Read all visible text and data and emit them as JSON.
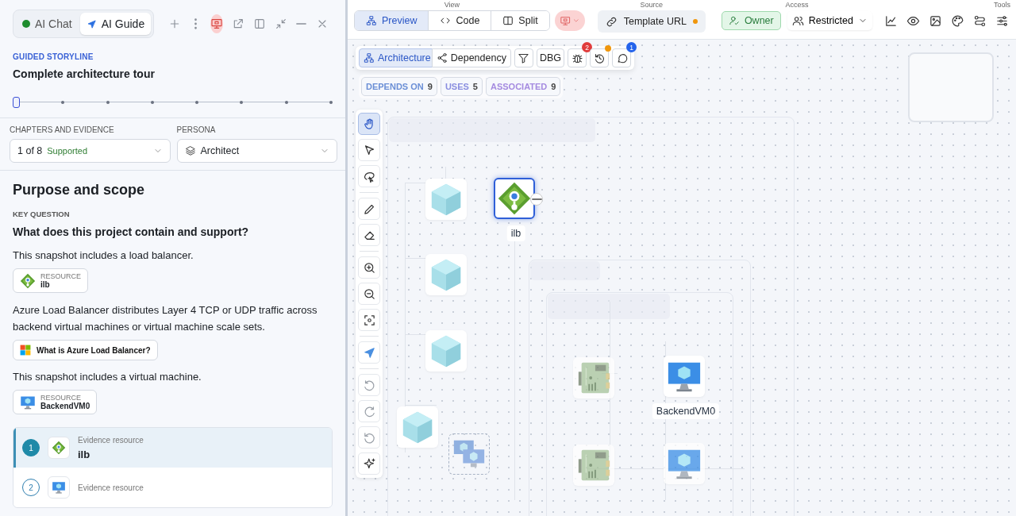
{
  "panel_tabs": [
    {
      "label": "AI Chat",
      "kind": "chat",
      "selected": false
    },
    {
      "label": "AI Guide",
      "kind": "guide",
      "selected": true
    }
  ],
  "panel_actions": [
    {
      "kind": "plus",
      "active": false
    },
    {
      "kind": "more",
      "active": false
    },
    {
      "kind": "present",
      "active": true
    },
    {
      "kind": "popout",
      "active": false
    },
    {
      "kind": "sidebar",
      "active": false
    },
    {
      "kind": "collapse",
      "active": false
    },
    {
      "kind": "minimize",
      "active": false
    },
    {
      "kind": "close",
      "active": false
    }
  ],
  "guide": {
    "eyebrow": "GUIDED STORYLINE",
    "title": "Complete architecture tour",
    "steps": [
      {
        "selected": true
      },
      {
        "selected": false
      },
      {
        "selected": false
      },
      {
        "selected": false
      },
      {
        "selected": false
      },
      {
        "selected": false
      },
      {
        "selected": false
      },
      {
        "selected": false
      }
    ]
  },
  "chapters": {
    "label": "CHAPTERS AND EVIDENCE",
    "value": "1 of 8",
    "status": "Supported"
  },
  "persona": {
    "label": "PERSONA",
    "value": "Architect"
  },
  "section": {
    "heading": "Purpose and scope",
    "key_label": "KEY QUESTION",
    "question": "What does this project contain and support?",
    "blocks": [
      {
        "kind": "text",
        "text": "This snapshot includes a load balancer."
      },
      {
        "kind": "lb_resource",
        "label": "RESOURCE",
        "name": "ilb"
      },
      {
        "kind": "text",
        "text": "Azure Load Balancer distributes Layer 4 TCP or UDP traffic across backend virtual machines or virtual machine scale sets."
      },
      {
        "kind": "link",
        "text": "What is Azure Load Balancer?"
      },
      {
        "kind": "text",
        "text": "This snapshot includes a virtual machine."
      },
      {
        "kind": "vm_resource",
        "label": "RESOURCE",
        "name": "BackendVM0"
      }
    ]
  },
  "evidence": [
    {
      "number": "1",
      "kind": "lb",
      "label": "Evidence resource",
      "name": "ilb",
      "selected": true
    },
    {
      "number": "2",
      "kind": "vm",
      "label": "Evidence resource",
      "selected": false
    }
  ],
  "topbar": {
    "view": {
      "label": "View",
      "tabs": [
        {
          "label": "Preview",
          "kind": "preview",
          "selected": true
        },
        {
          "label": "Code",
          "kind": "code",
          "selected": false
        },
        {
          "label": "Split",
          "kind": "split",
          "selected": false
        }
      ]
    },
    "source": {
      "label": "Source",
      "button": "Template URL",
      "modified": true
    },
    "access": {
      "label": "Access",
      "role": "Owner",
      "visibility": "Restricted"
    },
    "tools": {
      "label": "Tools",
      "items": [
        {
          "kind": "chart"
        },
        {
          "kind": "eye"
        },
        {
          "kind": "image"
        },
        {
          "kind": "palette"
        },
        {
          "kind": "flow"
        },
        {
          "kind": "sliders"
        }
      ]
    }
  },
  "canvas_toolbar": {
    "modes": [
      {
        "label": "Architecture",
        "kind": "arch",
        "selected": true
      },
      {
        "label": "Dependency",
        "kind": "dep",
        "selected": false
      }
    ],
    "debug": "DBG",
    "issues": "2",
    "history_dot": true,
    "comments": "1"
  },
  "filters": [
    {
      "label": "DEPENDS ON",
      "count": "9",
      "color": "#6b8fd6"
    },
    {
      "label": "USES",
      "count": "5",
      "color": "#8a8ee0"
    },
    {
      "label": "ASSOCIATED",
      "count": "9",
      "color": "#a58be0"
    }
  ],
  "tools": [
    {
      "kind": "hand",
      "selected": true
    },
    {
      "kind": "pointer",
      "selected": false
    },
    {
      "kind": "lasso",
      "selected": false
    },
    {
      "kind": "pencil",
      "selected": false
    },
    {
      "kind": "eraser",
      "selected": false
    },
    {
      "kind": "zoomin",
      "selected": false
    },
    {
      "kind": "zoomout",
      "selected": false
    },
    {
      "kind": "fit",
      "selected": false
    },
    {
      "kind": "send",
      "selected": false
    },
    {
      "kind": "undo",
      "selected": false
    },
    {
      "kind": "redo",
      "selected": false
    },
    {
      "kind": "reset",
      "selected": false
    },
    {
      "kind": "sparkle",
      "selected": false
    }
  ],
  "nodes": [
    {
      "kind": "cube",
      "selected": false
    },
    {
      "kind": "lb",
      "label": "ilb",
      "selected": true
    },
    {
      "kind": "cube",
      "selected": false
    },
    {
      "kind": "cube",
      "selected": false
    },
    {
      "kind": "cube",
      "selected": false
    },
    {
      "kind": "vmss",
      "selected": false
    },
    {
      "kind": "nic",
      "selected": false
    },
    {
      "kind": "vm",
      "label": "BackendVM0",
      "selected": false
    },
    {
      "kind": "nic",
      "selected": false
    },
    {
      "kind": "vm",
      "selected": false
    }
  ]
}
